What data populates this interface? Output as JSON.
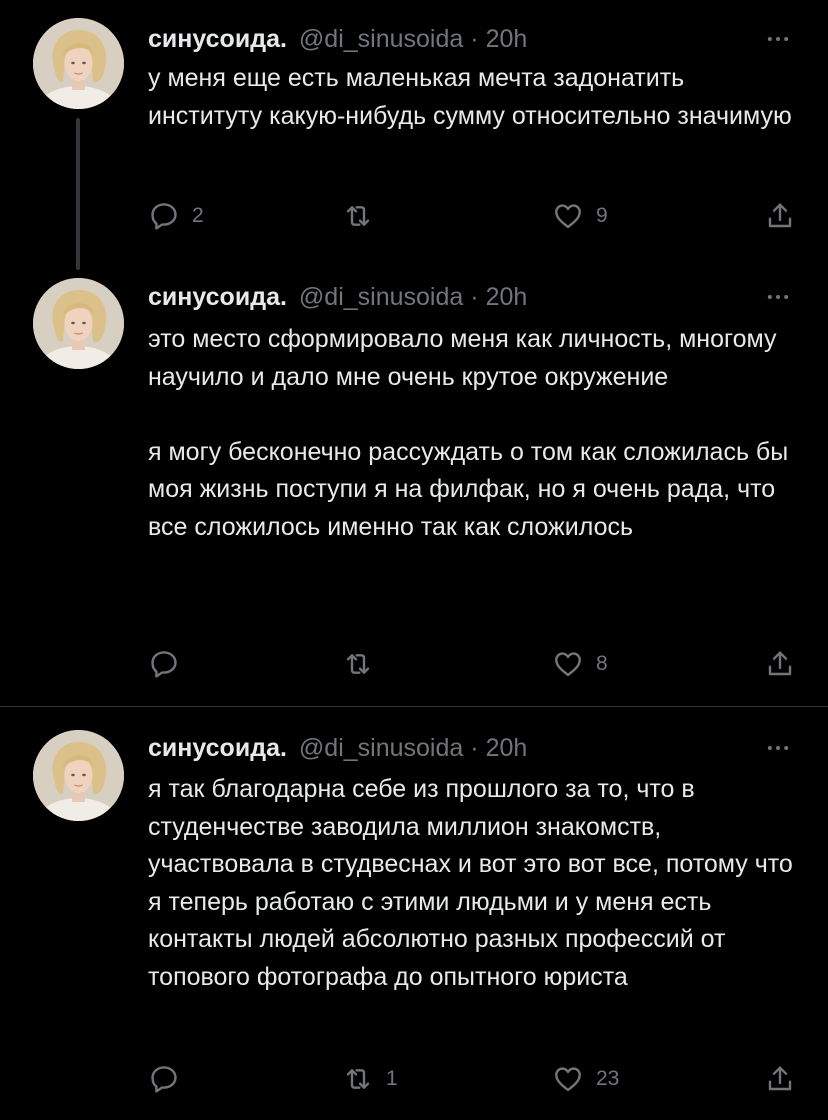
{
  "colors": {
    "background": "#000000",
    "text": "#e7e9ea",
    "secondary": "#71767b",
    "divider": "#2f3336"
  },
  "tweets": [
    {
      "author_name": "синусоида.",
      "handle": "@di_sinusoida",
      "separator": "·",
      "time": "20h",
      "paragraphs": [
        "у меня еще есть маленькая мечта задонатить институту какую-нибудь сумму относительно значимую"
      ],
      "replies": "2",
      "retweets": "",
      "likes": "9",
      "icons": [
        "reply-icon",
        "retweet-icon",
        "like-icon",
        "share-icon",
        "more-icon"
      ]
    },
    {
      "author_name": "синусоида.",
      "handle": "@di_sinusoida",
      "separator": "·",
      "time": "20h",
      "paragraphs": [
        "это место сформировало меня как личность, многому научило и дало мне очень крутое окружение",
        "я могу бесконечно рассуждать о том как сложилась бы моя жизнь поступи я на филфак, но я очень рада, что все сложилось именно так как сложилось"
      ],
      "replies": "",
      "retweets": "",
      "likes": "8",
      "icons": [
        "reply-icon",
        "retweet-icon",
        "like-icon",
        "share-icon",
        "more-icon"
      ]
    },
    {
      "author_name": "синусоида.",
      "handle": "@di_sinusoida",
      "separator": "·",
      "time": "20h",
      "paragraphs": [
        "я так благодарна себе из прошлого за то, что в студенчестве заводила миллион знакомств, участвовала в студвеснах и вот это вот все, потому что я теперь работаю с этими людьми и у меня есть контакты людей абсолютно разных профессий от топового фотографа до опытного юриста"
      ],
      "replies": "",
      "retweets": "1",
      "likes": "23",
      "icons": [
        "reply-icon",
        "retweet-icon",
        "like-icon",
        "share-icon",
        "more-icon"
      ]
    }
  ]
}
